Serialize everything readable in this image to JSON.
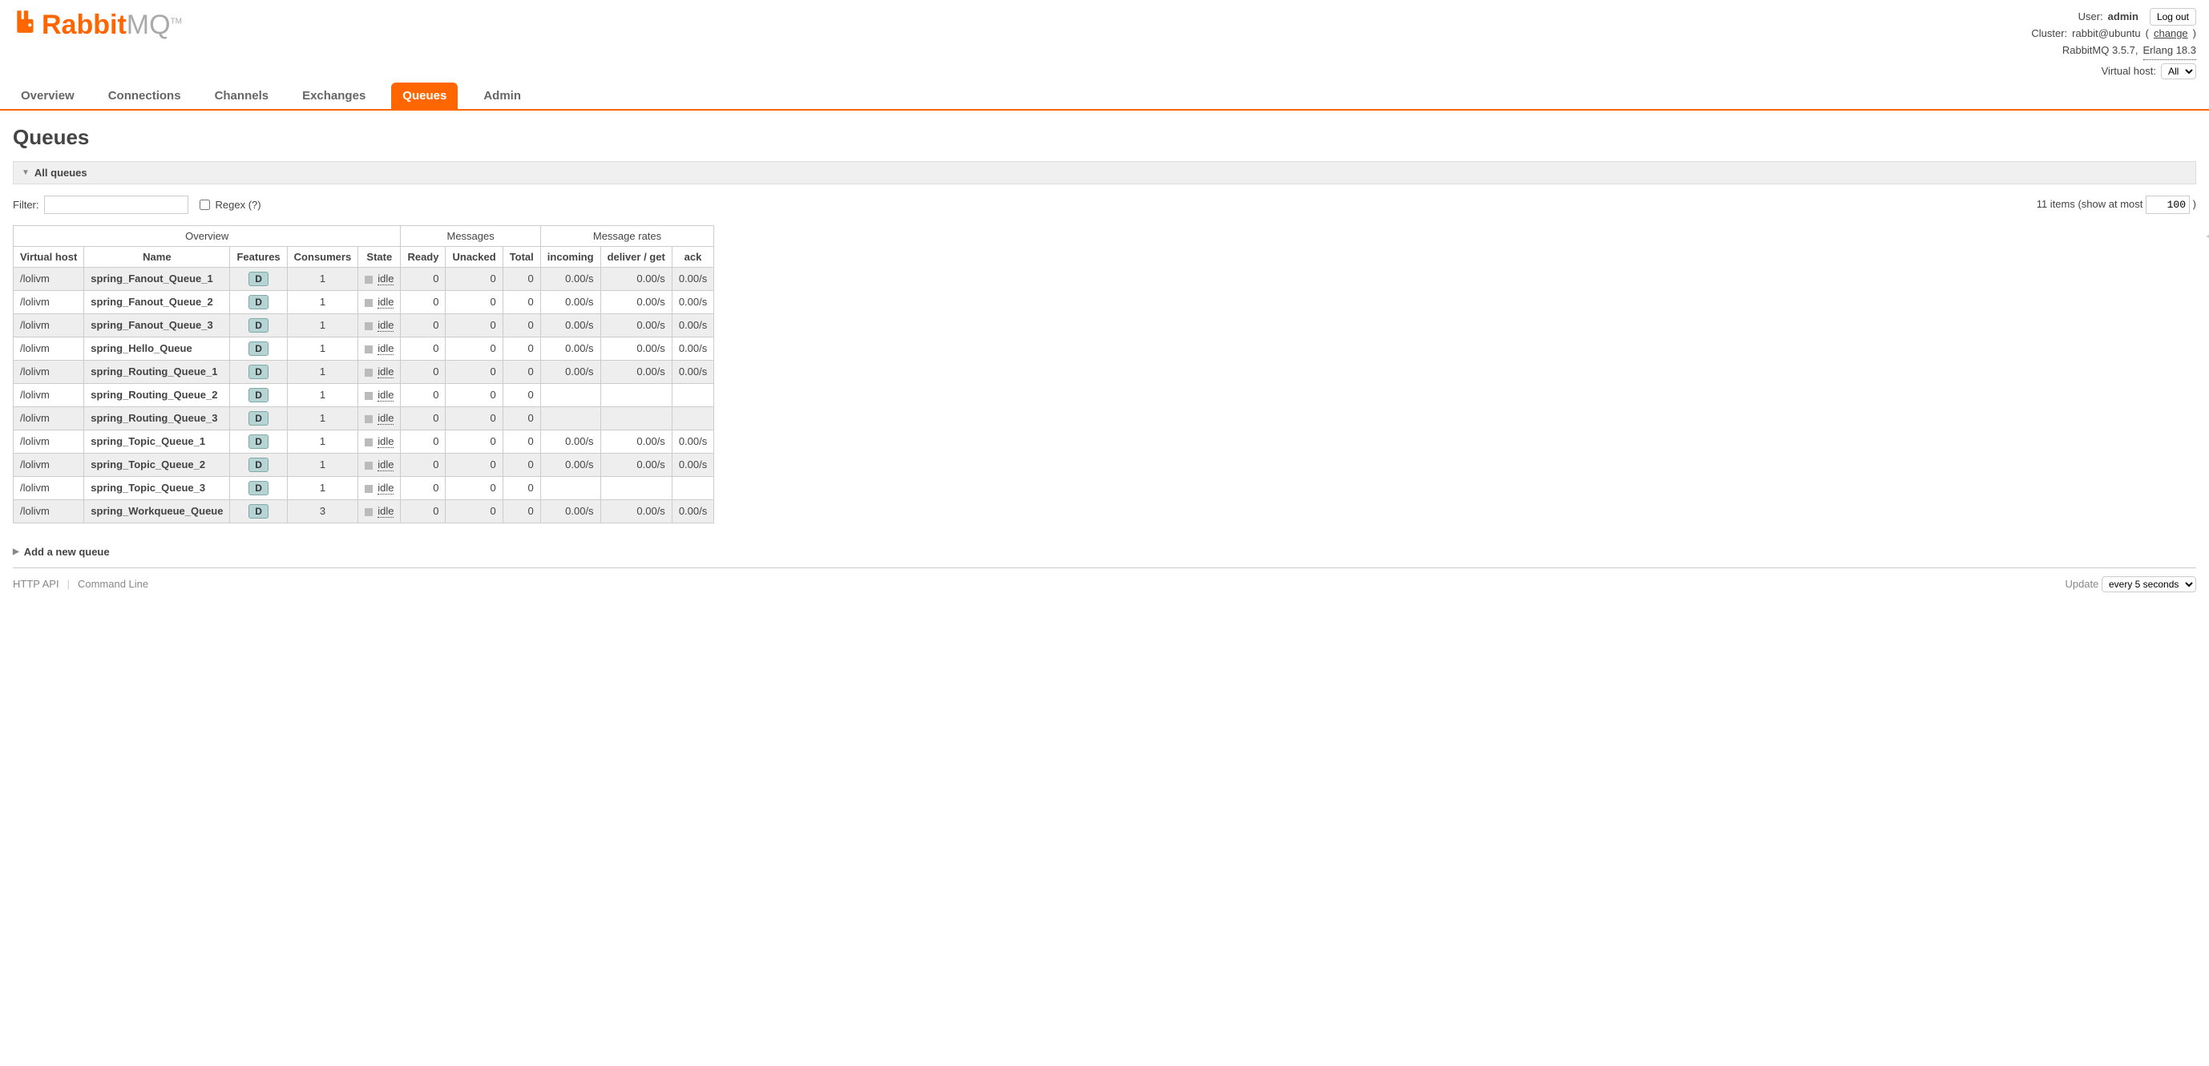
{
  "logo": {
    "brand1": "Rabbit",
    "brand2": "MQ",
    "tm": "TM"
  },
  "header": {
    "user_label": "User:",
    "user": "admin",
    "logout": "Log out",
    "cluster_label": "Cluster:",
    "cluster": "rabbit@ubuntu",
    "change": "change",
    "version": "RabbitMQ 3.5.7,",
    "erlang": "Erlang 18.3",
    "vhost_label": "Virtual host:",
    "vhost_value": "All"
  },
  "tabs": [
    "Overview",
    "Connections",
    "Channels",
    "Exchanges",
    "Queues",
    "Admin"
  ],
  "active_tab": "Queues",
  "page_title": "Queues",
  "sections": {
    "all_queues": "All queues",
    "add_new": "Add a new queue"
  },
  "filter": {
    "label": "Filter:",
    "regex": "Regex (?)",
    "items_text": "11 items (show at most",
    "max_value": "100",
    "close_paren": ")"
  },
  "table": {
    "plusminus": "+/-",
    "group_headers": [
      "Overview",
      "Messages",
      "Message rates"
    ],
    "col_headers": [
      "Virtual host",
      "Name",
      "Features",
      "Consumers",
      "State",
      "Ready",
      "Unacked",
      "Total",
      "incoming",
      "deliver / get",
      "ack"
    ],
    "rows": [
      {
        "vhost": "/lolivm",
        "name": "spring_Fanout_Queue_1",
        "feat": "D",
        "consumers": "1",
        "state": "idle",
        "ready": "0",
        "unacked": "0",
        "total": "0",
        "incoming": "0.00/s",
        "deliver": "0.00/s",
        "ack": "0.00/s"
      },
      {
        "vhost": "/lolivm",
        "name": "spring_Fanout_Queue_2",
        "feat": "D",
        "consumers": "1",
        "state": "idle",
        "ready": "0",
        "unacked": "0",
        "total": "0",
        "incoming": "0.00/s",
        "deliver": "0.00/s",
        "ack": "0.00/s"
      },
      {
        "vhost": "/lolivm",
        "name": "spring_Fanout_Queue_3",
        "feat": "D",
        "consumers": "1",
        "state": "idle",
        "ready": "0",
        "unacked": "0",
        "total": "0",
        "incoming": "0.00/s",
        "deliver": "0.00/s",
        "ack": "0.00/s"
      },
      {
        "vhost": "/lolivm",
        "name": "spring_Hello_Queue",
        "feat": "D",
        "consumers": "1",
        "state": "idle",
        "ready": "0",
        "unacked": "0",
        "total": "0",
        "incoming": "0.00/s",
        "deliver": "0.00/s",
        "ack": "0.00/s"
      },
      {
        "vhost": "/lolivm",
        "name": "spring_Routing_Queue_1",
        "feat": "D",
        "consumers": "1",
        "state": "idle",
        "ready": "0",
        "unacked": "0",
        "total": "0",
        "incoming": "0.00/s",
        "deliver": "0.00/s",
        "ack": "0.00/s"
      },
      {
        "vhost": "/lolivm",
        "name": "spring_Routing_Queue_2",
        "feat": "D",
        "consumers": "1",
        "state": "idle",
        "ready": "0",
        "unacked": "0",
        "total": "0",
        "incoming": "",
        "deliver": "",
        "ack": ""
      },
      {
        "vhost": "/lolivm",
        "name": "spring_Routing_Queue_3",
        "feat": "D",
        "consumers": "1",
        "state": "idle",
        "ready": "0",
        "unacked": "0",
        "total": "0",
        "incoming": "",
        "deliver": "",
        "ack": ""
      },
      {
        "vhost": "/lolivm",
        "name": "spring_Topic_Queue_1",
        "feat": "D",
        "consumers": "1",
        "state": "idle",
        "ready": "0",
        "unacked": "0",
        "total": "0",
        "incoming": "0.00/s",
        "deliver": "0.00/s",
        "ack": "0.00/s"
      },
      {
        "vhost": "/lolivm",
        "name": "spring_Topic_Queue_2",
        "feat": "D",
        "consumers": "1",
        "state": "idle",
        "ready": "0",
        "unacked": "0",
        "total": "0",
        "incoming": "0.00/s",
        "deliver": "0.00/s",
        "ack": "0.00/s"
      },
      {
        "vhost": "/lolivm",
        "name": "spring_Topic_Queue_3",
        "feat": "D",
        "consumers": "1",
        "state": "idle",
        "ready": "0",
        "unacked": "0",
        "total": "0",
        "incoming": "",
        "deliver": "",
        "ack": ""
      },
      {
        "vhost": "/lolivm",
        "name": "spring_Workqueue_Queue",
        "feat": "D",
        "consumers": "3",
        "state": "idle",
        "ready": "0",
        "unacked": "0",
        "total": "0",
        "incoming": "0.00/s",
        "deliver": "0.00/s",
        "ack": "0.00/s"
      }
    ]
  },
  "footer": {
    "http_api": "HTTP API",
    "cmdline": "Command Line",
    "update_label": "Update",
    "update_value": "every 5 seconds"
  }
}
